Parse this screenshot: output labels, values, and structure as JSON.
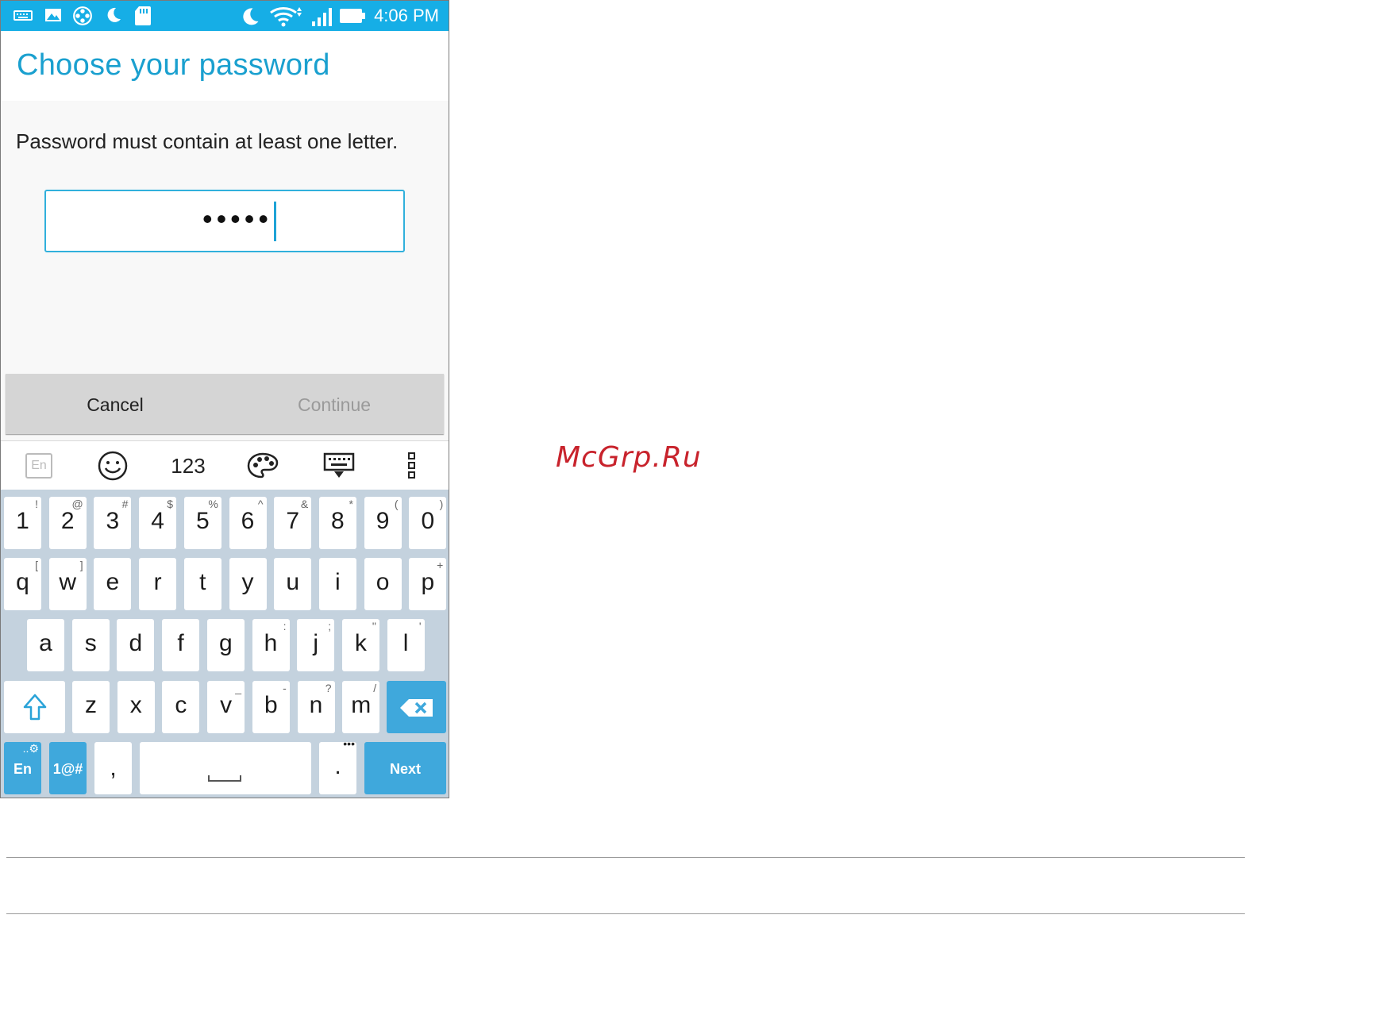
{
  "status_bar": {
    "time": "4:06 PM",
    "left_icons": [
      "keyboard-icon",
      "image-icon",
      "film-reel-icon",
      "moon-icon",
      "sd-card-icon"
    ],
    "right_icons": [
      "moon-icon",
      "wifi-icon",
      "signal-icon",
      "battery-icon"
    ],
    "color": "#16aee6"
  },
  "dialog": {
    "title": "Choose your password",
    "message": "Password must contain at least one letter.",
    "password_dots": "•••••",
    "cancel_label": "Cancel",
    "continue_label": "Continue"
  },
  "keyboard_toolbar": {
    "lang_label": "En",
    "numbers_label": "123",
    "icons": [
      "language-icon",
      "emoji-icon",
      "theme-palette-icon",
      "hide-keyboard-icon",
      "more-options-icon"
    ]
  },
  "keyboard": {
    "row1": [
      {
        "k": "1",
        "a": "!"
      },
      {
        "k": "2",
        "a": "@"
      },
      {
        "k": "3",
        "a": "#"
      },
      {
        "k": "4",
        "a": "$"
      },
      {
        "k": "5",
        "a": "%"
      },
      {
        "k": "6",
        "a": "^"
      },
      {
        "k": "7",
        "a": "&"
      },
      {
        "k": "8",
        "a": "*"
      },
      {
        "k": "9",
        "a": "("
      },
      {
        "k": "0",
        "a": ")"
      }
    ],
    "row2": [
      {
        "k": "q",
        "a": "["
      },
      {
        "k": "w",
        "a": "]"
      },
      {
        "k": "e",
        "a": ""
      },
      {
        "k": "r",
        "a": ""
      },
      {
        "k": "t",
        "a": ""
      },
      {
        "k": "y",
        "a": ""
      },
      {
        "k": "u",
        "a": ""
      },
      {
        "k": "i",
        "a": ""
      },
      {
        "k": "o",
        "a": ""
      },
      {
        "k": "p",
        "a": "+"
      }
    ],
    "row3": [
      {
        "k": "a",
        "a": ""
      },
      {
        "k": "s",
        "a": ""
      },
      {
        "k": "d",
        "a": ""
      },
      {
        "k": "f",
        "a": ""
      },
      {
        "k": "g",
        "a": ""
      },
      {
        "k": "h",
        "a": ":"
      },
      {
        "k": "j",
        "a": ";"
      },
      {
        "k": "k",
        "a": "\""
      },
      {
        "k": "l",
        "a": "'"
      }
    ],
    "row4": [
      {
        "k": "z",
        "a": ""
      },
      {
        "k": "x",
        "a": ""
      },
      {
        "k": "c",
        "a": ""
      },
      {
        "k": "v",
        "a": "_"
      },
      {
        "k": "b",
        "a": "-"
      },
      {
        "k": "n",
        "a": "?"
      },
      {
        "k": "m",
        "a": "/"
      }
    ],
    "lang_key": "En",
    "symbols_key": "1@#",
    "comma_key": ",",
    "period_key": ".",
    "period_alt": "•••",
    "next_key": "Next",
    "accent_color": "#3fa8dc"
  },
  "watermark": "McGrp.Ru"
}
